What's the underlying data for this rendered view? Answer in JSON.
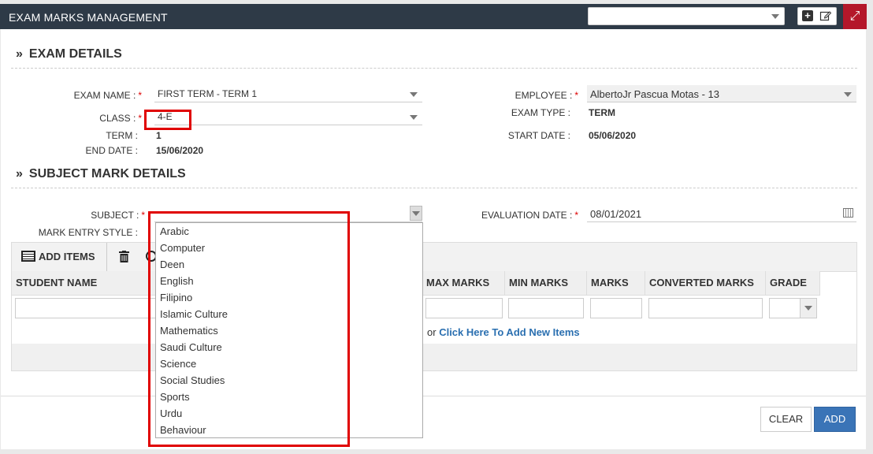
{
  "header": {
    "title": "EXAM MARKS MANAGEMENT",
    "top_select_value": "",
    "add_icon": "plus-square-icon",
    "edit_icon": "edit-icon",
    "expand_icon": "expand-icon",
    "accent_color": "#b4172a"
  },
  "exam_details": {
    "section_title": "EXAM DETAILS",
    "exam_name_label": "EXAM NAME :",
    "exam_name_value": "FIRST TERM - TERM 1",
    "class_label": "CLASS :",
    "class_value": "4-E",
    "term_label": "TERM :",
    "term_value": "1",
    "end_date_label": "END DATE :",
    "end_date_value": "15/06/2020",
    "employee_label": "EMPLOYEE :",
    "employee_value": "AlbertoJr Pascua Motas - 13",
    "exam_type_label": "EXAM TYPE :",
    "exam_type_value": "TERM",
    "start_date_label": "START DATE :",
    "start_date_value": "05/06/2020"
  },
  "subject_details": {
    "section_title": "SUBJECT MARK DETAILS",
    "subject_label": "SUBJECT :",
    "subject_value": "",
    "mark_entry_style_label": "MARK ENTRY STYLE :",
    "evaluation_date_label": "EVALUATION DATE :",
    "evaluation_date_value": "08/01/2021"
  },
  "grid": {
    "add_items_label": "ADD ITEMS",
    "columns": [
      "STUDENT NAME",
      "MAX MARKS",
      "MIN MARKS",
      "MARKS",
      "CONVERTED MARKS",
      "GRADE"
    ],
    "or_text": "or",
    "add_new_link": "Click Here To Add New Items"
  },
  "subject_dropdown": {
    "options": [
      "Arabic",
      "Computer",
      "Deen",
      "English",
      "Filipino",
      "Islamic Culture",
      "Mathematics",
      "Saudi Culture",
      "Science",
      "Social Studies",
      "Sports",
      "Urdu",
      "Behaviour"
    ]
  },
  "buttons": {
    "clear": "CLEAR",
    "add": "ADD"
  }
}
